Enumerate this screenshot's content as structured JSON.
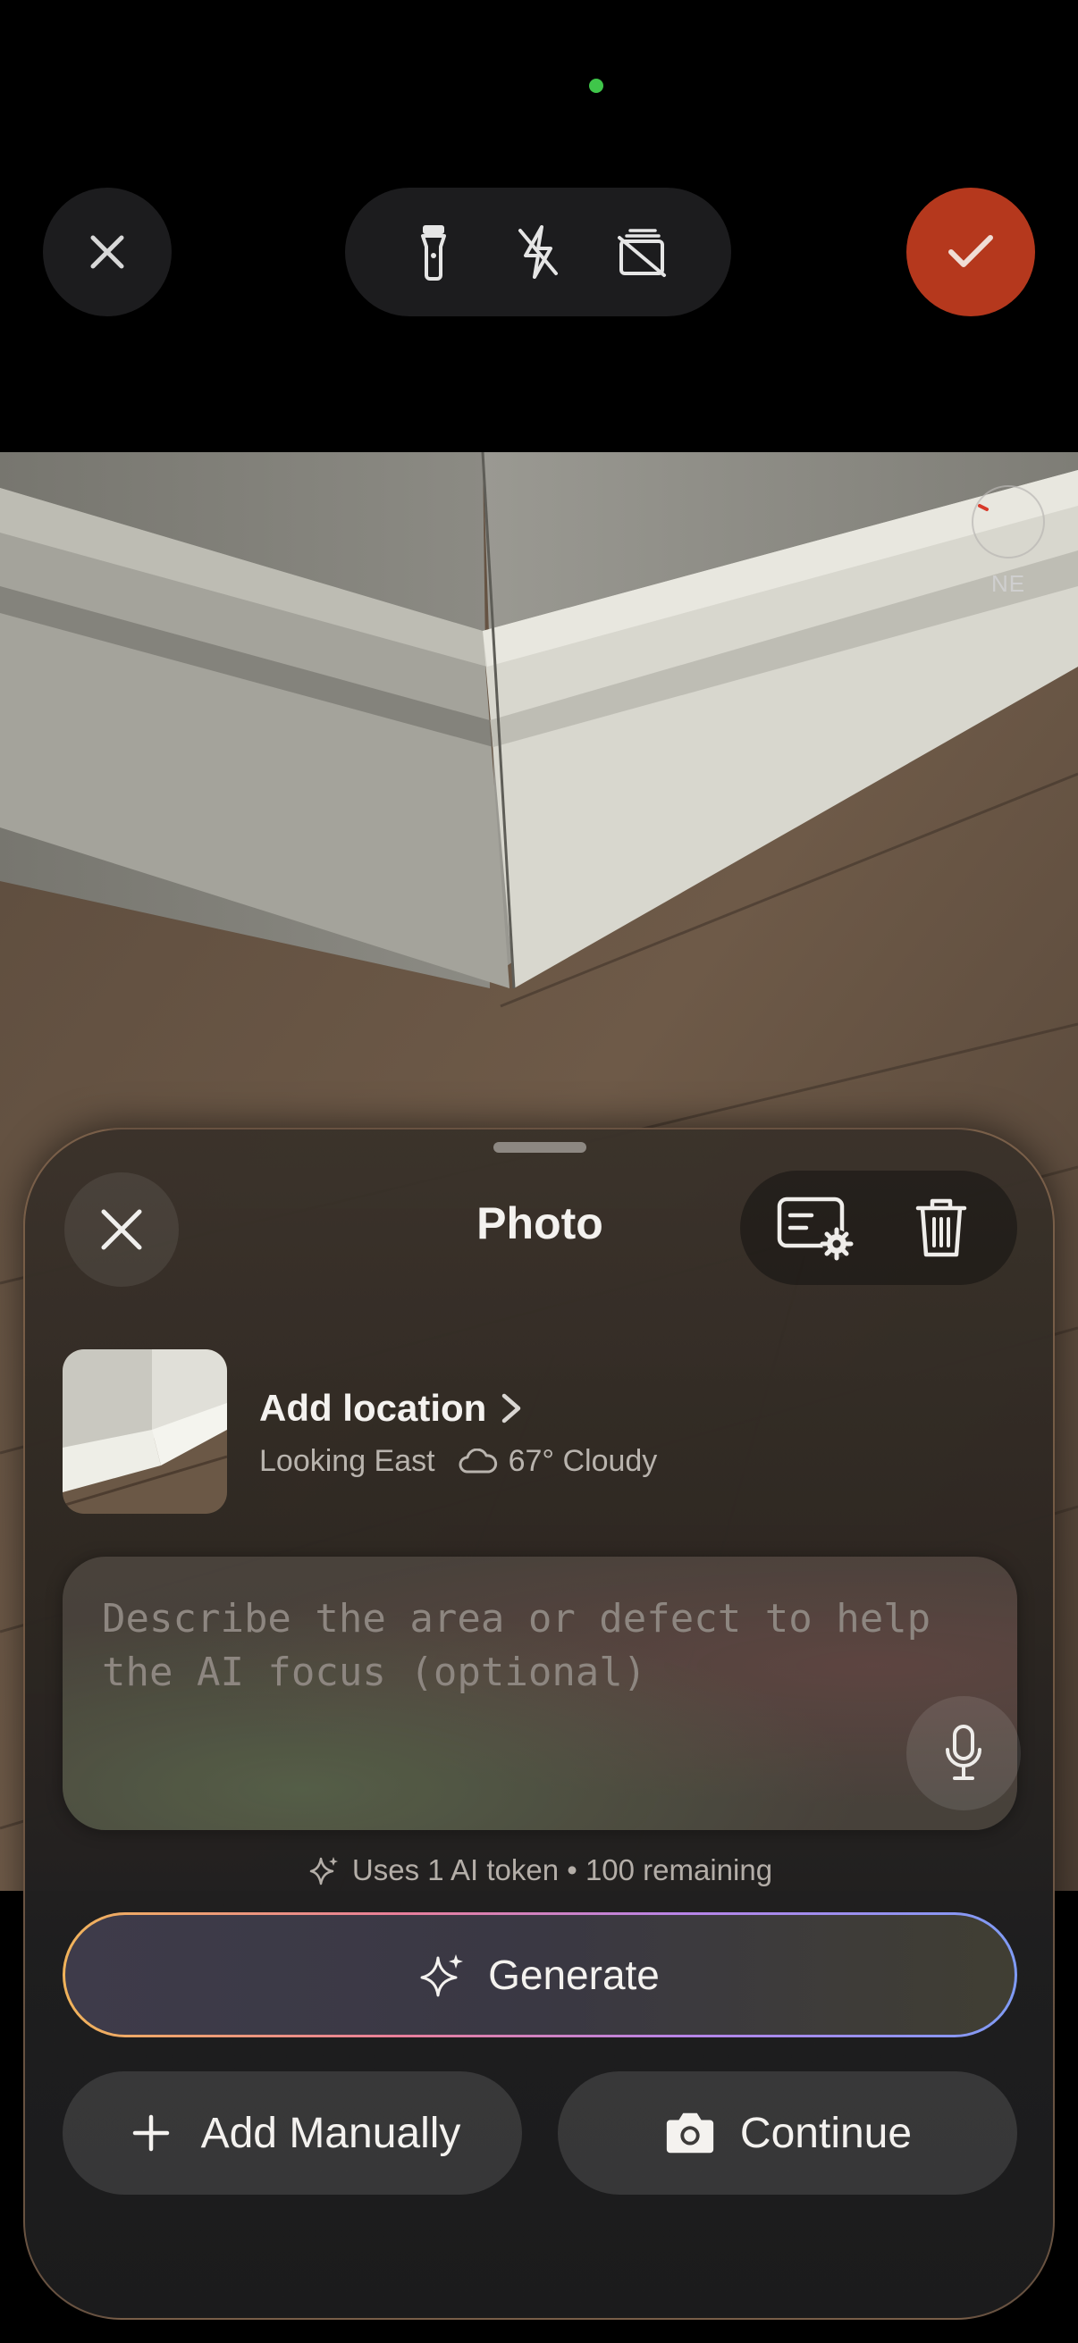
{
  "camera_bar": {
    "close_icon": "close-icon",
    "tools": [
      "flashlight-icon",
      "flash-off-icon",
      "stack-off-icon"
    ],
    "confirm_icon": "checkmark-icon",
    "accent_color": "#b5381d",
    "recording_dot_color": "#3fc64a"
  },
  "compass": {
    "heading": "NE"
  },
  "sheet": {
    "title": "Photo",
    "location": {
      "title": "Add location",
      "direction": "Looking East",
      "weather": "67° Cloudy"
    },
    "prompt": {
      "placeholder": "Describe the area or defect to help the AI focus (optional)",
      "value": ""
    },
    "token_note": "Uses 1 AI token • 100 remaining",
    "generate_label": "Generate",
    "add_manually_label": "Add Manually",
    "continue_label": "Continue"
  }
}
